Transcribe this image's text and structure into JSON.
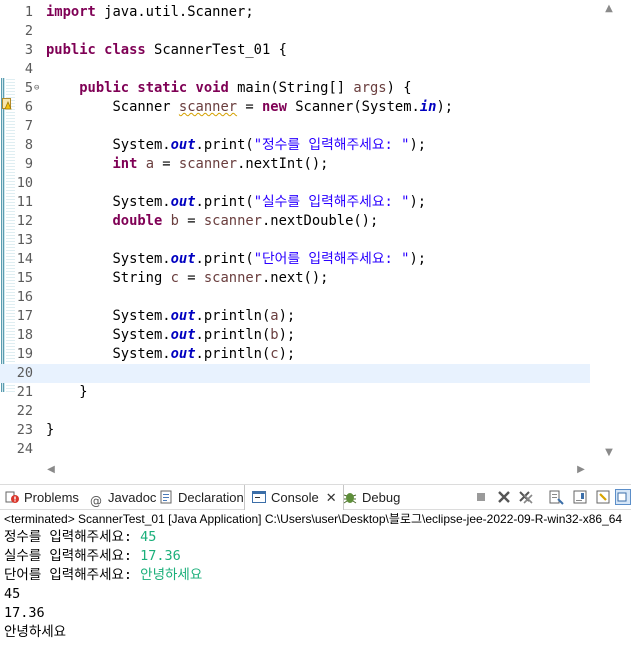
{
  "editor": {
    "warning_line": "6",
    "current_line": "20",
    "lines": [
      {
        "n": "1",
        "tokens": [
          {
            "t": "import",
            "c": "kw"
          },
          {
            "t": " java.util.Scanner;"
          }
        ]
      },
      {
        "n": "2",
        "tokens": []
      },
      {
        "n": "3",
        "tokens": [
          {
            "t": "public",
            "c": "kw"
          },
          {
            "t": " "
          },
          {
            "t": "class",
            "c": "kw"
          },
          {
            "t": " ScannerTest_01 {"
          }
        ]
      },
      {
        "n": "4",
        "tokens": []
      },
      {
        "n": "5",
        "fold": "⊖",
        "tokens": [
          {
            "t": "    "
          },
          {
            "t": "public",
            "c": "kw"
          },
          {
            "t": " "
          },
          {
            "t": "static",
            "c": "kw"
          },
          {
            "t": " "
          },
          {
            "t": "void",
            "c": "kw"
          },
          {
            "t": " main(String[] "
          },
          {
            "t": "args",
            "c": "var"
          },
          {
            "t": ") {"
          }
        ]
      },
      {
        "n": "6",
        "tokens": [
          {
            "t": "        Scanner "
          },
          {
            "t": "scanner",
            "c": "var squig"
          },
          {
            "t": " = "
          },
          {
            "t": "new",
            "c": "kw"
          },
          {
            "t": " Scanner(System."
          },
          {
            "t": "in",
            "c": "st"
          },
          {
            "t": ");"
          }
        ]
      },
      {
        "n": "7",
        "tokens": []
      },
      {
        "n": "8",
        "tokens": [
          {
            "t": "        System."
          },
          {
            "t": "out",
            "c": "st"
          },
          {
            "t": ".print("
          },
          {
            "t": "\"정수를 입력해주세요: \"",
            "c": "str"
          },
          {
            "t": ");"
          }
        ]
      },
      {
        "n": "9",
        "tokens": [
          {
            "t": "        "
          },
          {
            "t": "int",
            "c": "kw"
          },
          {
            "t": " "
          },
          {
            "t": "a",
            "c": "var"
          },
          {
            "t": " = "
          },
          {
            "t": "scanner",
            "c": "var"
          },
          {
            "t": ".nextInt();"
          }
        ]
      },
      {
        "n": "10",
        "tokens": []
      },
      {
        "n": "11",
        "tokens": [
          {
            "t": "        System."
          },
          {
            "t": "out",
            "c": "st"
          },
          {
            "t": ".print("
          },
          {
            "t": "\"실수를 입력해주세요: \"",
            "c": "str"
          },
          {
            "t": ");"
          }
        ]
      },
      {
        "n": "12",
        "tokens": [
          {
            "t": "        "
          },
          {
            "t": "double",
            "c": "kw"
          },
          {
            "t": " "
          },
          {
            "t": "b",
            "c": "var"
          },
          {
            "t": " = "
          },
          {
            "t": "scanner",
            "c": "var"
          },
          {
            "t": ".nextDouble();"
          }
        ]
      },
      {
        "n": "13",
        "tokens": []
      },
      {
        "n": "14",
        "tokens": [
          {
            "t": "        System."
          },
          {
            "t": "out",
            "c": "st"
          },
          {
            "t": ".print("
          },
          {
            "t": "\"단어를 입력해주세요: \"",
            "c": "str"
          },
          {
            "t": ");"
          }
        ]
      },
      {
        "n": "15",
        "tokens": [
          {
            "t": "        String "
          },
          {
            "t": "c",
            "c": "var"
          },
          {
            "t": " = "
          },
          {
            "t": "scanner",
            "c": "var"
          },
          {
            "t": ".next();"
          }
        ]
      },
      {
        "n": "16",
        "tokens": []
      },
      {
        "n": "17",
        "tokens": [
          {
            "t": "        System."
          },
          {
            "t": "out",
            "c": "st"
          },
          {
            "t": ".println("
          },
          {
            "t": "a",
            "c": "var"
          },
          {
            "t": ");"
          }
        ]
      },
      {
        "n": "18",
        "tokens": [
          {
            "t": "        System."
          },
          {
            "t": "out",
            "c": "st"
          },
          {
            "t": ".println("
          },
          {
            "t": "b",
            "c": "var"
          },
          {
            "t": ");"
          }
        ]
      },
      {
        "n": "19",
        "tokens": [
          {
            "t": "        System."
          },
          {
            "t": "out",
            "c": "st"
          },
          {
            "t": ".println("
          },
          {
            "t": "c",
            "c": "var"
          },
          {
            "t": ");"
          }
        ]
      },
      {
        "n": "20",
        "tokens": []
      },
      {
        "n": "21",
        "tokens": [
          {
            "t": "    }"
          }
        ]
      },
      {
        "n": "22",
        "tokens": []
      },
      {
        "n": "23",
        "tokens": [
          {
            "t": "}"
          }
        ]
      },
      {
        "n": "24",
        "tokens": []
      }
    ]
  },
  "views": {
    "tabs": [
      {
        "label": "Problems",
        "icon": "problems-icon"
      },
      {
        "label": "Javadoc",
        "icon": "javadoc-icon"
      },
      {
        "label": "Declaration",
        "icon": "declaration-icon"
      },
      {
        "label": "Console",
        "icon": "console-icon",
        "active": true
      },
      {
        "label": "Debug",
        "icon": "debug-icon"
      }
    ]
  },
  "console": {
    "status": "<terminated> ScannerTest_01 [Java Application] C:\\Users\\user\\Desktop\\블로그\\eclipse-jee-2022-09-R-win32-x86_64",
    "lines": [
      {
        "prompt": "정수를 입력해주세요: ",
        "input": "45"
      },
      {
        "prompt": "실수를 입력해주세요: ",
        "input": "17.36"
      },
      {
        "prompt": "단어를 입력해주세요: ",
        "input": "안녕하세요"
      },
      {
        "prompt": "45",
        "input": ""
      },
      {
        "prompt": "17.36",
        "input": ""
      },
      {
        "prompt": "안녕하세요",
        "input": ""
      }
    ]
  },
  "colors": {
    "keyword": "#7f0055",
    "string": "#2a00ff",
    "static_field": "#0000c0",
    "input_text": "#1aaf7a",
    "current_line": "#e8f2fe"
  }
}
